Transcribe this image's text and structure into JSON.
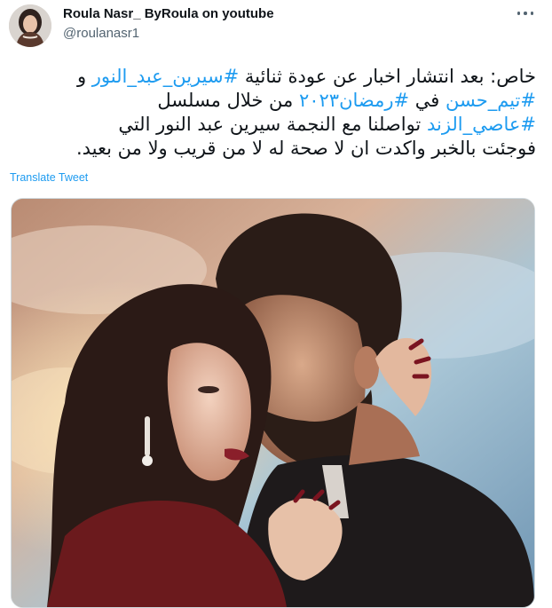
{
  "author": {
    "name": "Roula Nasr_ ByRoula on youtube",
    "handle": "@roulanasr1"
  },
  "tweet": {
    "lines": [
      [
        {
          "t": "خاص: بعد انتشار اخبار عن عودة ثنائية ",
          "tag": false
        },
        {
          "t": "#سيرين_عبد_النور",
          "tag": true
        },
        {
          "t": " و",
          "tag": false
        }
      ],
      [
        {
          "t": "#تيم_حسن",
          "tag": true
        },
        {
          "t": " في ",
          "tag": false
        },
        {
          "t": "#رمضان٢٠٢٣",
          "tag": true
        },
        {
          "t": " من خلال مسلسل",
          "tag": false
        }
      ],
      [
        {
          "t": "#عاصي_الزند",
          "tag": true
        },
        {
          "t": " تواصلنا مع النجمة سيرين عبد النور التي",
          "tag": false
        }
      ],
      [
        {
          "t": "فوجئت بالخبر واكدت ان لا صحة له لا من قريب ولا من بعيد.",
          "tag": false
        }
      ]
    ],
    "translate_label": "Translate Tweet"
  },
  "icons": {
    "more": "more-horizontal-icon"
  },
  "colors": {
    "link": "#1d9bf0",
    "text": "#0f1419",
    "secondary": "#536471"
  }
}
